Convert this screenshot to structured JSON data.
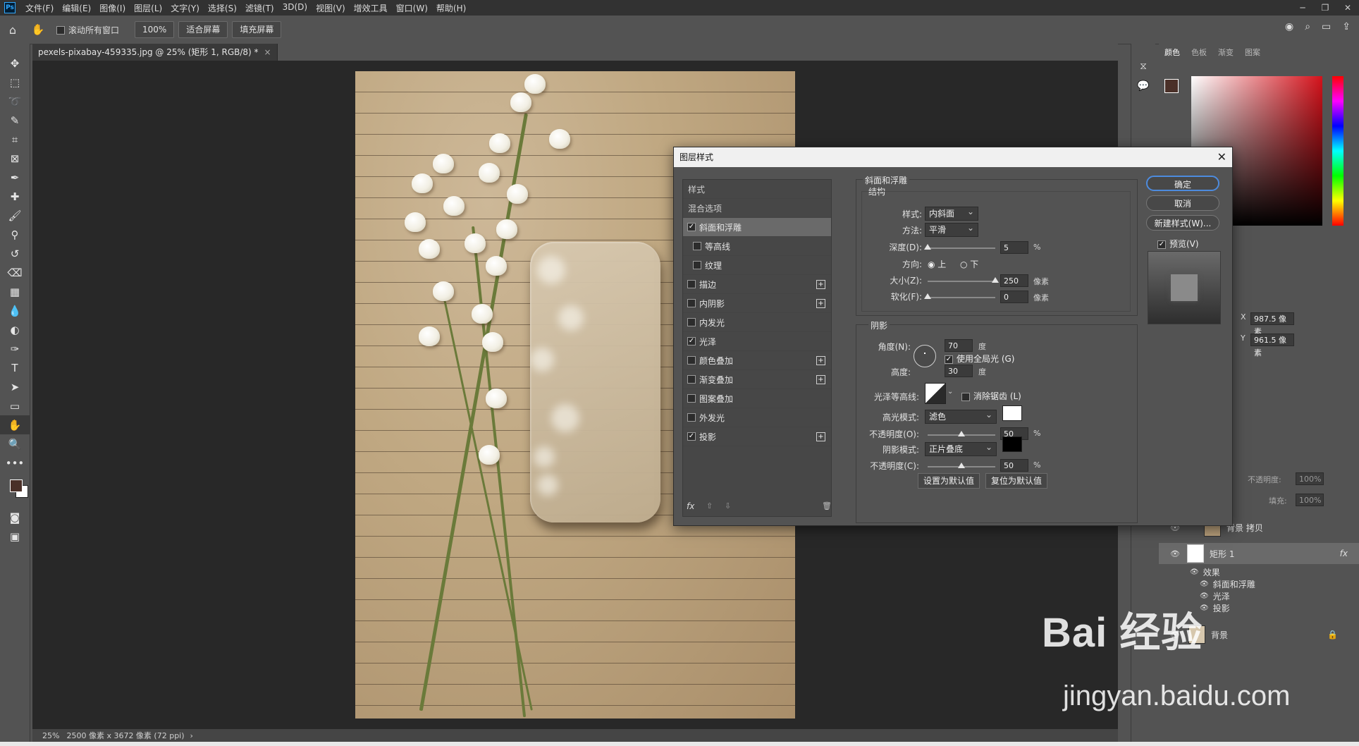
{
  "app": {
    "logo": "Ps"
  },
  "menu": [
    "文件(F)",
    "编辑(E)",
    "图像(I)",
    "图层(L)",
    "文字(Y)",
    "选择(S)",
    "滤镜(T)",
    "3D(D)",
    "视图(V)",
    "增效工具",
    "窗口(W)",
    "帮助(H)"
  ],
  "options": {
    "scroll_all": "滚动所有窗口",
    "zoom": "100%",
    "fit_screen": "适合屏幕",
    "fill_screen": "填充屏幕"
  },
  "document": {
    "tab_title": "pexels-pixabay-459335.jpg @ 25% (矩形 1, RGB/8) *"
  },
  "status": {
    "zoom": "25%",
    "info": "2500 像素 x 3672 像素 (72 ppi)"
  },
  "panels": {
    "color_tabs": [
      "颜色",
      "色板",
      "渐变",
      "图案"
    ],
    "properties": {
      "x_label": "X",
      "x_value": "987.5 像素",
      "y_label": "Y",
      "y_value": "961.5 像素"
    },
    "layers_opts": {
      "opacity_label": "不透明度:",
      "opacity": "100%",
      "fill_label": "填充:",
      "fill": "100%"
    },
    "layers": {
      "bg_copy": "背景 拷贝",
      "rect": "矩形 1",
      "fx": "fx",
      "effects": "效果",
      "effect_items": [
        "斜面和浮雕",
        "光泽",
        "投影"
      ],
      "bg": "背景"
    }
  },
  "dialog": {
    "title": "图层样式",
    "style_list": {
      "header": "样式",
      "blend": "混合选项",
      "items": [
        {
          "label": "斜面和浮雕",
          "checked": true,
          "selected": true,
          "indent": false,
          "plus": false
        },
        {
          "label": "等高线",
          "checked": false,
          "indent": true,
          "plus": false
        },
        {
          "label": "纹理",
          "checked": false,
          "indent": true,
          "plus": false
        },
        {
          "label": "描边",
          "checked": false,
          "indent": false,
          "plus": true
        },
        {
          "label": "内阴影",
          "checked": false,
          "indent": false,
          "plus": true
        },
        {
          "label": "内发光",
          "checked": false,
          "indent": false,
          "plus": false
        },
        {
          "label": "光泽",
          "checked": true,
          "indent": false,
          "plus": false
        },
        {
          "label": "颜色叠加",
          "checked": false,
          "indent": false,
          "plus": true
        },
        {
          "label": "渐变叠加",
          "checked": false,
          "indent": false,
          "plus": true
        },
        {
          "label": "图案叠加",
          "checked": false,
          "indent": false,
          "plus": false
        },
        {
          "label": "外发光",
          "checked": false,
          "indent": false,
          "plus": false
        },
        {
          "label": "投影",
          "checked": true,
          "indent": false,
          "plus": true
        }
      ],
      "fx": "fx"
    },
    "bevel": {
      "section": "斜面和浮雕",
      "structure": "结构",
      "style_label": "样式:",
      "style_value": "内斜面",
      "method_label": "方法:",
      "method_value": "平滑",
      "depth_label": "深度(D):",
      "depth_value": "5",
      "depth_unit": "%",
      "depth_level": 0.0,
      "direction_label": "方向:",
      "dir_up": "上",
      "dir_down": "下",
      "size_label": "大小(Z):",
      "size_value": "250",
      "size_unit": "像素",
      "size_level": 1.0,
      "soften_label": "软化(F):",
      "soften_value": "0",
      "soften_unit": "像素",
      "soften_level": 0.0
    },
    "shading": {
      "section": "阴影",
      "angle_label": "角度(N):",
      "angle_value": "70",
      "angle_unit": "度",
      "global_light": "使用全局光 (G)",
      "altitude_label": "高度:",
      "altitude_value": "30",
      "altitude_unit": "度",
      "gloss_label": "光泽等高线:",
      "anti_alias": "消除锯齿 (L)",
      "highlight_label": "高光模式:",
      "highlight_value": "滤色",
      "highlight_color": "#ffffff",
      "hl_opacity_label": "不透明度(O):",
      "hl_opacity_value": "50",
      "hl_opacity_unit": "%",
      "hl_level": 0.5,
      "shadow_label": "阴影模式:",
      "shadow_value": "正片叠底",
      "shadow_color": "#000000",
      "sh_opacity_label": "不透明度(C):",
      "sh_opacity_value": "50",
      "sh_opacity_unit": "%",
      "sh_level": 0.5
    },
    "buttons": {
      "make_default": "设置为默认值",
      "reset_default": "复位为默认值",
      "ok": "确定",
      "cancel": "取消",
      "new_style": "新建样式(W)...",
      "preview": "预览(V)"
    }
  },
  "watermark": {
    "brand": "Bai 经验",
    "url": "jingyan.baidu.com"
  }
}
